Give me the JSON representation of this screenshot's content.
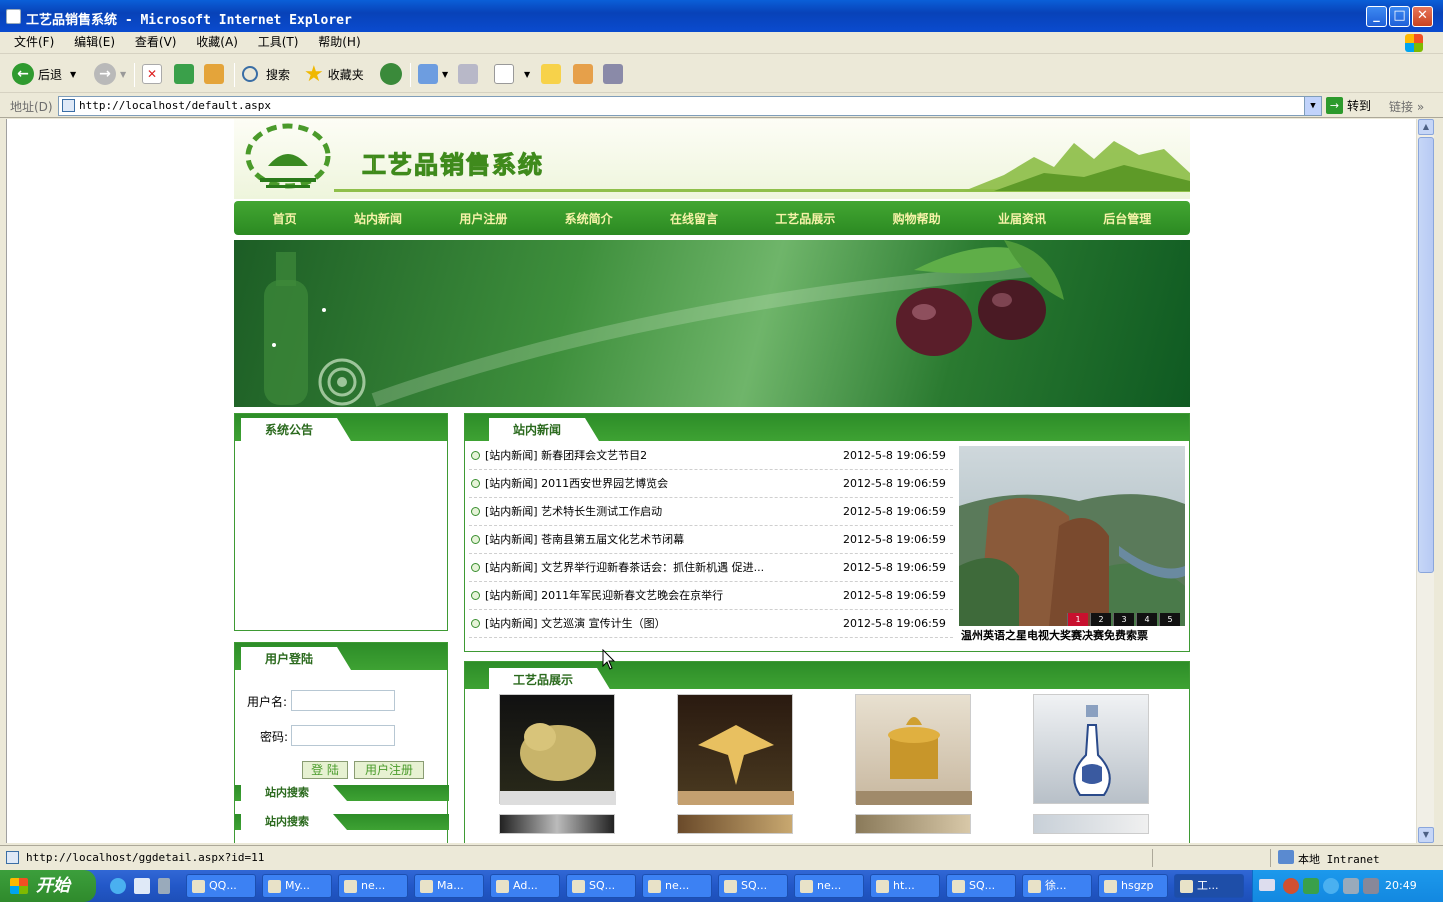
{
  "window": {
    "title": "工艺品销售系统 - Microsoft Internet Explorer"
  },
  "menu": [
    "文件(F)",
    "编辑(E)",
    "查看(V)",
    "收藏(A)",
    "工具(T)",
    "帮助(H)"
  ],
  "toolbar": {
    "back": "后退",
    "search": "搜索",
    "favorites": "收藏夹"
  },
  "address": {
    "label": "地址(D)",
    "url": "http://localhost/default.aspx",
    "go": "转到",
    "links": "链接"
  },
  "site": {
    "title": "工艺品销售系统",
    "nav": [
      "首页",
      "站内新闻",
      "用户注册",
      "系统简介",
      "在线留言",
      "工艺品展示",
      "购物帮助",
      "业届资讯",
      "后台管理"
    ],
    "notice_title": "系统公告",
    "login": {
      "title": "用户登陆",
      "username_label": "用户名:",
      "password_label": "密码:",
      "login_btn": "登 陆",
      "register_btn": "用户注册"
    },
    "search_title_1": "站内搜索",
    "search_title_2": "站内搜索",
    "news": {
      "title": "站内新闻",
      "items": [
        {
          "title": "[站内新闻] 新春团拜会文艺节目2",
          "date": "2012-5-8 19:06:59"
        },
        {
          "title": "[站内新闻] 2011西安世界园艺博览会",
          "date": "2012-5-8 19:06:59"
        },
        {
          "title": "[站内新闻] 艺术特长生测试工作启动",
          "date": "2012-5-8 19:06:59"
        },
        {
          "title": "[站内新闻] 苍南县第五届文化艺术节闭幕",
          "date": "2012-5-8 19:06:59"
        },
        {
          "title": "[站内新闻] 文艺界举行迎新春茶话会：抓住新机遇 促进...",
          "date": "2012-5-8 19:06:59"
        },
        {
          "title": "[站内新闻] 2011年军民迎新春文艺晚会在京举行",
          "date": "2012-5-8 19:06:59"
        },
        {
          "title": "[站内新闻] 文艺巡演 宣传计生（图）",
          "date": "2012-5-8 19:06:59"
        }
      ],
      "slide_caption": "温州英语之星电视大奖赛决赛免费索票",
      "slide_pages": [
        "1",
        "2",
        "3",
        "4",
        "5"
      ],
      "slide_active": 1
    },
    "products_title": "工艺品展示"
  },
  "status": {
    "url": "http://localhost/ggdetail.aspx?id=11",
    "zone": "本地 Intranet"
  },
  "taskbar": {
    "start": "开始",
    "tasks": [
      "QQ...",
      "My...",
      "ne...",
      "Ma...",
      "Ad...",
      "SQ...",
      "ne...",
      "SQ...",
      "ne...",
      "ht...",
      "SQ...",
      "徐...",
      "hsgzp",
      "工..."
    ],
    "clock": "20:49"
  }
}
